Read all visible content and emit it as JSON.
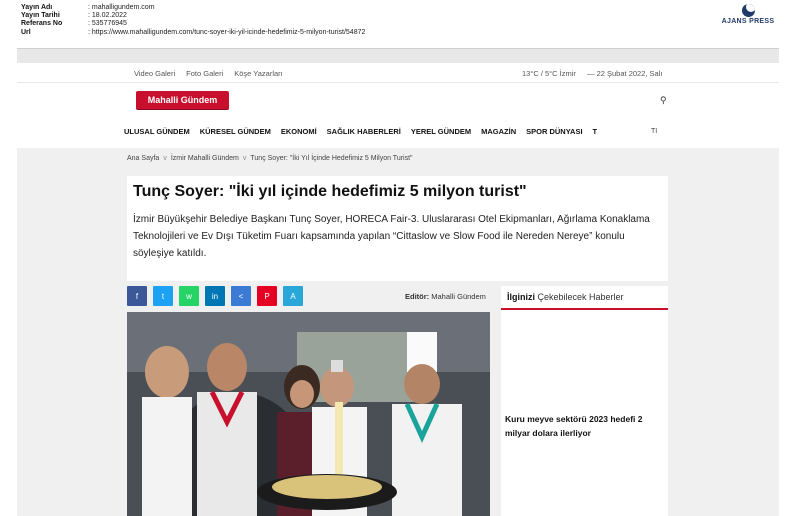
{
  "clip": {
    "rows": [
      {
        "key": "Yayın Adı",
        "value": ": mahalligundem.com"
      },
      {
        "key": "Yayın Tarihi",
        "value": ": 18.02.2022"
      },
      {
        "key": "Referans No",
        "value": ": 535776945"
      },
      {
        "key": "Url",
        "value": ": https://www.mahalligundem.com/tunc-soyer-iki-yil-icinde-hedefimiz-5-milyon-turist/54872"
      }
    ],
    "agency": "AJANS PRESS"
  },
  "site": {
    "topnav": {
      "links": [
        "Video Galeri",
        "Foto Galeri",
        "Köşe Yazarları"
      ],
      "weather": "13°C / 5°C İzmir",
      "date": "— 22 Şubat 2022, Salı"
    },
    "logo": "Mahalli Gündem",
    "search_icon": "search-icon",
    "mainnav": [
      "ULUSAL GÜNDEM",
      "KÜRESEL GÜNDEM",
      "EKONOMİ",
      "SAĞLIK HABERLERİ",
      "YEREL GÜNDEM",
      "MAGAZİN",
      "SPOR DÜNYASI"
    ],
    "nav_more": "T",
    "nav_extra": "TI"
  },
  "breadcrumb": {
    "items": [
      "Ana Sayfa",
      "İzmir Mahalli Gündem",
      "Tunç Soyer: \"İki Yıl İçinde Hedefimiz 5 Milyon Turist\""
    ],
    "separator": "v"
  },
  "article": {
    "title": "Tunç Soyer: \"İki yıl içinde hedefimiz 5 milyon turist\"",
    "summary": "İzmir Büyükşehir Belediye Başkanı Tunç Soyer, HORECA Fair-3. Uluslararası Otel Ekipmanları, Ağırlama Konaklama Teknolojileri ve Ev Dışı Tüketim Fuarı kapsamında yapılan “Cittaslow ve Slow Food ile Nereden Nereye” konulu söyleşiye katıldı.",
    "editor_label": "Editör:",
    "editor_name": "Mahalli Gündem",
    "share_buttons": [
      {
        "icon": "facebook-icon",
        "glyph": "f",
        "color": "#3b5998"
      },
      {
        "icon": "twitter-icon",
        "glyph": "t",
        "color": "#1da1f2"
      },
      {
        "icon": "whatsapp-icon",
        "glyph": "w",
        "color": "#25d366"
      },
      {
        "icon": "linkedin-icon",
        "glyph": "in",
        "color": "#0077b5"
      },
      {
        "icon": "share-icon",
        "glyph": "<",
        "color": "#3b7bd4"
      },
      {
        "icon": "pinterest-icon",
        "glyph": "P",
        "color": "#e60023"
      },
      {
        "icon": "font-size-icon",
        "glyph": "A",
        "color": "#2aa7d9"
      }
    ]
  },
  "sidebar": {
    "head_bold": "İlginizi",
    "head_rest": " Çekebilecek Haberler",
    "item": "Kuru meyve sektörü 2023 hedefi 2 milyar dolara ilerliyor"
  }
}
